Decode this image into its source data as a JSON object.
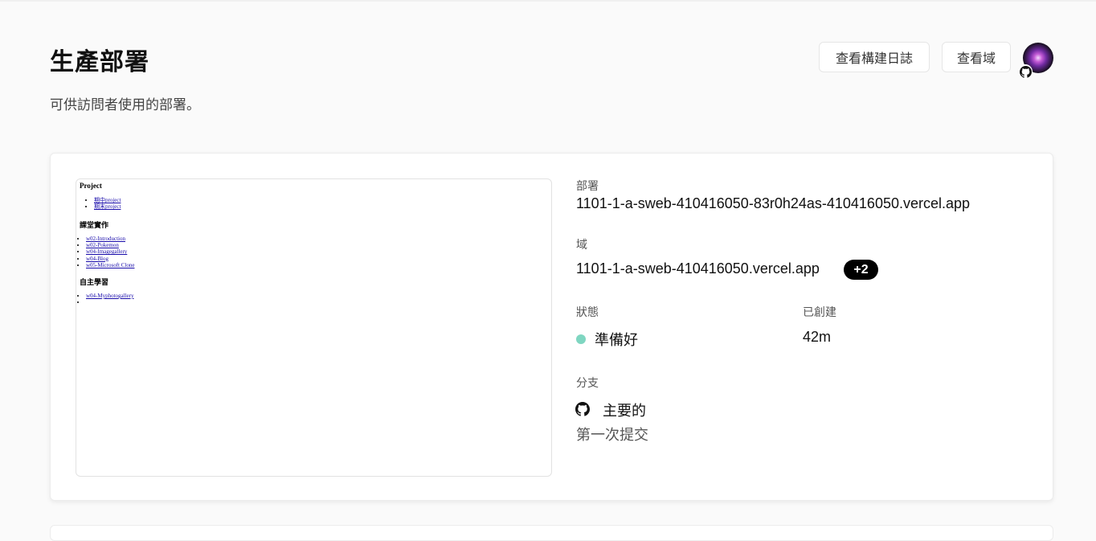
{
  "header": {
    "title": "生產部署",
    "subtitle": "可供訪問者使用的部署。",
    "view_logs_label": "查看構建日誌",
    "view_domains_label": "查看域"
  },
  "preview": {
    "sections": [
      {
        "heading": "Project",
        "links": [
          "期中project",
          "期末project"
        ]
      },
      {
        "heading": "課堂實作",
        "links": [
          "w02-Introduction",
          "w02-Pokemon",
          "w04-Imagegallery",
          "w04-Blog",
          "w05-Microsoft Clone"
        ]
      },
      {
        "heading": "自主學習",
        "links": [
          "w04-Myphotogallery",
          ""
        ]
      }
    ]
  },
  "deployment": {
    "deployment_label": "部署",
    "deployment_url": "1101-1-a-sweb-410416050-83r0h24as-410416050.vercel.app",
    "domain_label": "域",
    "domain_url": "1101-1-a-sweb-410416050.vercel.app",
    "domain_extra_badge": "+2",
    "status_label": "狀態",
    "status_value": "準備好",
    "status_color": "#7fd6c1",
    "created_label": "已創建",
    "created_value": "42m",
    "branch_label": "分支",
    "branch_value": "主要的",
    "branch_icon": "github-icon",
    "commit_message": "第一次提交"
  },
  "colors": {
    "background": "#fafafa",
    "card": "#ffffff",
    "badge_bg": "#000000",
    "link": "#1a0dab"
  }
}
